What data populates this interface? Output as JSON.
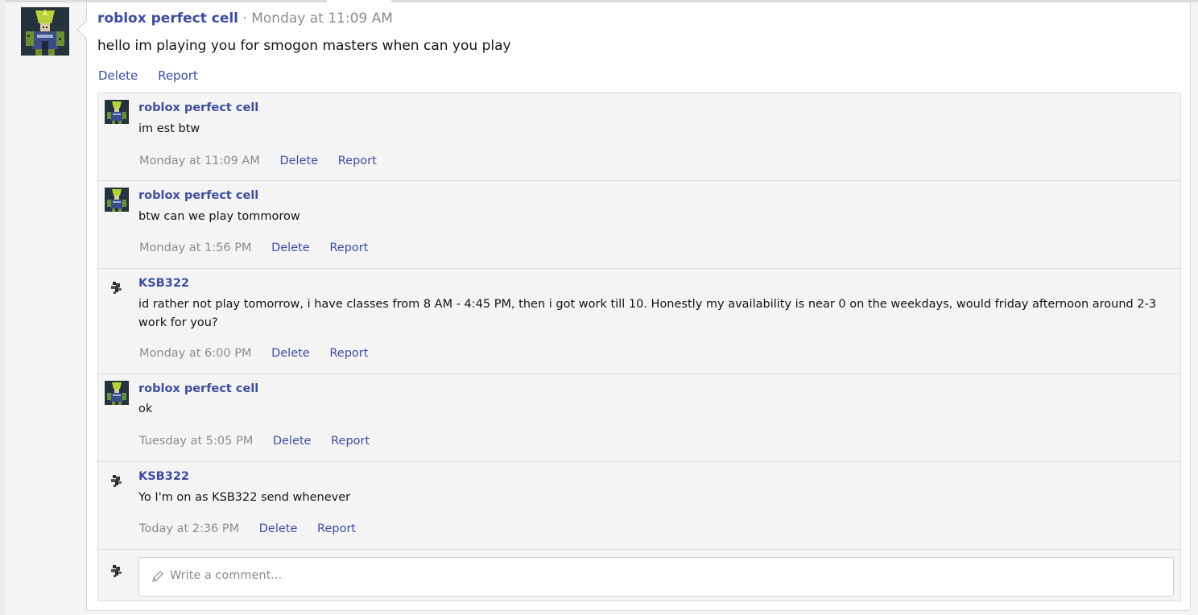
{
  "colors": {
    "link": "#3e4da0",
    "muted": "#8c8c8c",
    "panel": "#f4f4f4",
    "border": "#dcdcdc"
  },
  "post": {
    "author": "roblox perfect cell",
    "separator": "·",
    "time": "Monday at 11:09 AM",
    "body": "hello im playing you for smogon masters when can you play",
    "delete_label": "Delete",
    "report_label": "Report",
    "avatar_icon": "perfect-cell-avatar-icon"
  },
  "comments": [
    {
      "author": "roblox perfect cell",
      "avatar_icon": "perfect-cell-avatar-icon",
      "text": "im est btw",
      "time": "Monday at 11:09 AM",
      "delete_label": "Delete",
      "report_label": "Report"
    },
    {
      "author": "roblox perfect cell",
      "avatar_icon": "perfect-cell-avatar-icon",
      "text": "btw can we play tommorow",
      "time": "Monday at 1:56 PM",
      "delete_label": "Delete",
      "report_label": "Report"
    },
    {
      "author": "KSB322",
      "avatar_icon": "pixel-sprite-avatar-icon",
      "text": "id rather not play tomorrow, i have classes from 8 AM - 4:45 PM, then i got work till 10. Honestly my availability is near 0 on the weekdays, would friday afternoon around 2-3 work for you?",
      "time": "Monday at 6:00 PM",
      "delete_label": "Delete",
      "report_label": "Report"
    },
    {
      "author": "roblox perfect cell",
      "avatar_icon": "perfect-cell-avatar-icon",
      "text": "ok",
      "time": "Tuesday at 5:05 PM",
      "delete_label": "Delete",
      "report_label": "Report"
    },
    {
      "author": "KSB322",
      "avatar_icon": "pixel-sprite-avatar-icon",
      "text": "Yo I'm on as KSB322 send whenever",
      "time": "Today at 2:36 PM",
      "delete_label": "Delete",
      "report_label": "Report"
    }
  ],
  "reply": {
    "placeholder": "Write a comment...",
    "avatar_icon": "pixel-sprite-avatar-icon",
    "pencil_icon": "pencil-icon"
  }
}
